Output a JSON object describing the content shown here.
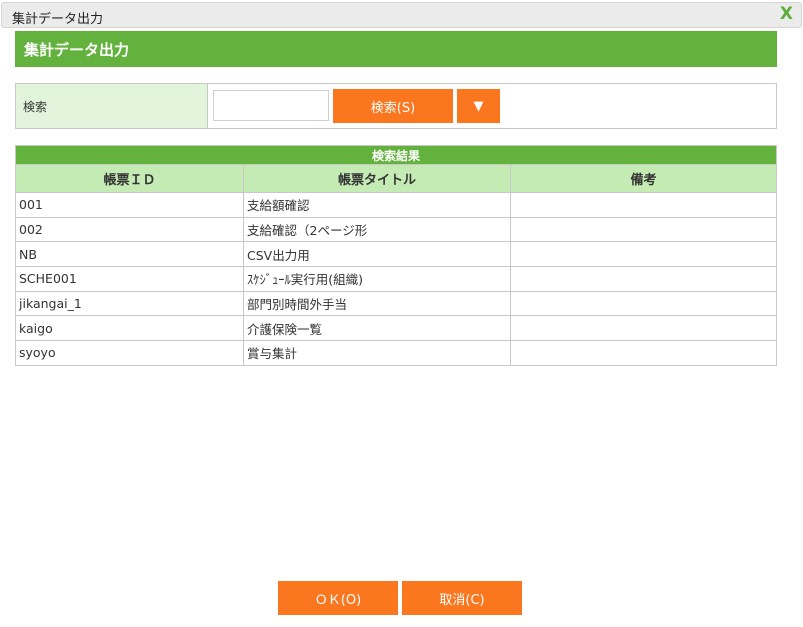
{
  "window": {
    "title": "集計データ出力",
    "close": "X"
  },
  "header": {
    "title": "集計データ出力"
  },
  "search": {
    "label": "検索",
    "value": "",
    "button": "検索(S)",
    "dropdown": "▼"
  },
  "results": {
    "caption": "検索結果",
    "columns": [
      "帳票ＩＤ",
      "帳票タイトル",
      "備考"
    ],
    "rows": [
      [
        "001",
        "支給額確認",
        ""
      ],
      [
        "002",
        "支給確認（2ページ形",
        ""
      ],
      [
        "NB",
        "CSV出力用",
        ""
      ],
      [
        "SCHE001",
        "ｽｹｼﾞｭｰﾙ実行用(組織)",
        ""
      ],
      [
        "jikangai_1",
        "部門別時間外手当",
        ""
      ],
      [
        "kaigo",
        "介護保険一覧",
        ""
      ],
      [
        "syoyo",
        "賞与集計",
        ""
      ]
    ]
  },
  "footer": {
    "ok": "ＯＫ(O)",
    "cancel": "取消(C)"
  }
}
